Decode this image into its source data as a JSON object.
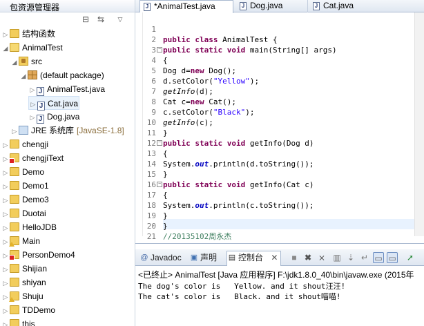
{
  "explorer": {
    "title": "包资源管理器",
    "items": [
      {
        "label": "结构函数",
        "arrow": "▷",
        "icon": "project-folder-icon",
        "indent": 0
      },
      {
        "label": "AnimalTest",
        "arrow": "◢",
        "icon": "project-folder-open-icon",
        "indent": 0
      },
      {
        "label": "src",
        "arrow": "◢",
        "icon": "source-folder-icon",
        "indent": 1
      },
      {
        "label": "(default package)",
        "arrow": "◢",
        "icon": "package-icon",
        "indent": 2
      },
      {
        "label": "AnimalTest.java",
        "arrow": "▷",
        "icon": "java-file-icon",
        "indent": 3
      },
      {
        "label": "Cat.java",
        "arrow": "▷",
        "icon": "java-file-icon",
        "indent": 3,
        "selected": true
      },
      {
        "label": "Dog.java",
        "arrow": "▷",
        "icon": "java-file-icon",
        "indent": 3
      },
      {
        "label": "JRE 系统库",
        "tag": "[JavaSE-1.8]",
        "arrow": "▷",
        "icon": "jre-library-icon",
        "indent": 1
      },
      {
        "label": "chengji",
        "arrow": "▷",
        "icon": "project-folder-icon",
        "indent": 0
      },
      {
        "label": "chengjiText",
        "arrow": "▷",
        "icon": "project-error-icon",
        "indent": 0
      },
      {
        "label": "Demo",
        "arrow": "▷",
        "icon": "project-folder-icon",
        "indent": 0
      },
      {
        "label": "Demo1",
        "arrow": "▷",
        "icon": "project-folder-icon",
        "indent": 0
      },
      {
        "label": "Demo3",
        "arrow": "▷",
        "icon": "project-folder-icon",
        "indent": 0
      },
      {
        "label": "Duotai",
        "arrow": "▷",
        "icon": "project-folder-icon",
        "indent": 0
      },
      {
        "label": "HelloJDB",
        "arrow": "▷",
        "icon": "project-folder-icon",
        "indent": 0
      },
      {
        "label": "Main",
        "arrow": "▷",
        "icon": "project-warning-icon",
        "indent": 0
      },
      {
        "label": "PersonDemo4",
        "arrow": "▷",
        "icon": "project-error-icon",
        "indent": 0
      },
      {
        "label": "Shijian",
        "arrow": "▷",
        "icon": "project-folder-icon",
        "indent": 0
      },
      {
        "label": "shiyan",
        "arrow": "▷",
        "icon": "project-folder-icon",
        "indent": 0
      },
      {
        "label": "Shuju",
        "arrow": "▷",
        "icon": "project-warning-icon",
        "indent": 0
      },
      {
        "label": "TDDemo",
        "arrow": "▷",
        "icon": "project-folder-icon",
        "indent": 0
      },
      {
        "label": "this",
        "arrow": "▷",
        "icon": "project-folder-icon",
        "indent": 0
      }
    ]
  },
  "editor": {
    "tabs": [
      {
        "label": "*AnimalTest.java",
        "active": true
      },
      {
        "label": "Dog.java",
        "active": false
      },
      {
        "label": "Cat.java",
        "active": false
      }
    ],
    "lines": [
      {
        "n": "1",
        "html": ""
      },
      {
        "n": "2",
        "html": "<span class='kw'>public class</span> AnimalTest {"
      },
      {
        "n": "3",
        "fold": "⊖",
        "html": "<span class='kw'>public static void</span> main(String[] args)"
      },
      {
        "n": "4",
        "html": "{"
      },
      {
        "n": "5",
        "html": "Dog d=<span class='kw'>new</span> Dog();"
      },
      {
        "n": "6",
        "html": "d.setColor(<span class='str'>\"Yellow\"</span>);"
      },
      {
        "n": "7",
        "html": "<span class='ital'>getInfo</span>(d);"
      },
      {
        "n": "8",
        "html": "Cat c=<span class='kw'>new</span> Cat();"
      },
      {
        "n": "9",
        "html": "c.setColor(<span class='str'>\"Black\"</span>);"
      },
      {
        "n": "10",
        "html": "<span class='ital'>getInfo</span>(c);"
      },
      {
        "n": "11",
        "html": "}"
      },
      {
        "n": "12",
        "fold": "⊖",
        "html": "<span class='kw'>public static void</span> getInfo(Dog d)"
      },
      {
        "n": "13",
        "html": "{"
      },
      {
        "n": "14",
        "html": "System.<span class='stat'>out</span>.println(d.toString());"
      },
      {
        "n": "15",
        "html": "}"
      },
      {
        "n": "16",
        "fold": "⊖",
        "html": "<span class='kw'>public static void</span> getInfo(Cat c)"
      },
      {
        "n": "17",
        "html": "{"
      },
      {
        "n": "18",
        "html": "System.<span class='stat'>out</span>.println(c.toString());"
      },
      {
        "n": "19",
        "html": "}"
      },
      {
        "n": "20",
        "html": "}"
      },
      {
        "n": "21",
        "html": "<span class='cmt'>//20135102周永杰</span>"
      }
    ]
  },
  "console": {
    "tabs": {
      "javadoc": "Javadoc",
      "declaration": "声明",
      "console": "控制台"
    },
    "status": "<已终止> AnimalTest [Java 应用程序] F:\\jdk1.8.0_40\\bin\\javaw.exe (2015年",
    "output": [
      "The dog's color is   Yellow. and it shout汪汪!",
      "The cat's color is   Black. and it shout喵喵!"
    ]
  },
  "colors": {
    "keyword": "#7f0055",
    "string": "#2a00ff",
    "comment": "#3f7f5f",
    "static_field": "#0000c0",
    "current_line": "#e8f2fe"
  }
}
